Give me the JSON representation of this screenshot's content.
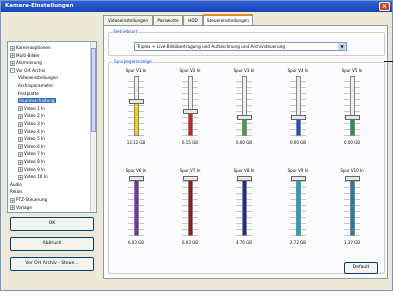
{
  "window": {
    "title": "Kamera-Einstellungen",
    "close": "×"
  },
  "tree": {
    "items": [
      {
        "label": "Kameraoptionen",
        "level": 1,
        "exp": "+"
      },
      {
        "label": "Multi-Bilder",
        "level": 1,
        "exp": "+"
      },
      {
        "label": "Alarmierung",
        "level": 1,
        "exp": "+"
      },
      {
        "label": "Vor Ort Archiv",
        "level": 1,
        "exp": "-"
      },
      {
        "label": "Videoeinstellungen",
        "level": 2
      },
      {
        "label": "Archivparameter",
        "level": 2
      },
      {
        "label": "Festplatte",
        "level": 2
      },
      {
        "label": "Stummschaltung",
        "level": 2,
        "selected": true
      },
      {
        "label": "Video 1 In",
        "level": 2,
        "exp": "+"
      },
      {
        "label": "Video 2 In",
        "level": 2,
        "exp": "+"
      },
      {
        "label": "Video 3 In",
        "level": 2,
        "exp": "+"
      },
      {
        "label": "Video 4 In",
        "level": 2,
        "exp": "+"
      },
      {
        "label": "Video 5 In",
        "level": 2,
        "exp": "+"
      },
      {
        "label": "Video 6 In",
        "level": 2,
        "exp": "+"
      },
      {
        "label": "Video 7 In",
        "level": 2,
        "exp": "+"
      },
      {
        "label": "Video 8 In",
        "level": 2,
        "exp": "+"
      },
      {
        "label": "Video 9 In",
        "level": 2,
        "exp": "+"
      },
      {
        "label": "Video 10 In",
        "level": 2,
        "exp": "+"
      },
      {
        "label": "Audio",
        "level": 1
      },
      {
        "label": "Relais",
        "level": 1
      },
      {
        "label": "PTZ-Steuerung",
        "level": 1,
        "exp": "+"
      },
      {
        "label": "Vorlage",
        "level": 1,
        "exp": "+"
      }
    ]
  },
  "buttons": {
    "ok": "OK",
    "cancel": "Abbruch",
    "copy": "Vor Ort Archiv - Steue...",
    "default": "Default"
  },
  "tabs": [
    {
      "label": "Videoeinstellungen",
      "active": false
    },
    {
      "label": "Passworte",
      "active": false
    },
    {
      "label": "HDD",
      "active": false
    },
    {
      "label": "Steuereinstellungen",
      "active": true
    }
  ],
  "groups": {
    "mode_title": "Betriebsart",
    "mode_value": "Triplex + Live-Bildübertragung und Aufzeichnung und Archivsteuerung",
    "levels_title": "Spurpegelanzeige"
  },
  "channels": [
    {
      "label": "Spur V1 In",
      "value": "13.12 GB",
      "color": "#f5d10a",
      "level": 0.58
    },
    {
      "label": "Spur V2 In",
      "value": "6.15 GB",
      "color": "#d21e1e",
      "level": 0.42
    },
    {
      "label": "Spur V3 In",
      "value": "0.00 GB",
      "color": "#39a43a",
      "level": 0.32
    },
    {
      "label": "Spur V4 In",
      "value": "0.00 GB",
      "color": "#1f4fc4",
      "level": 0.32
    },
    {
      "label": "Spur V5 In",
      "value": "0.00 GB",
      "color": "#1f9a3e",
      "level": 0.32
    },
    {
      "label": "Spur V6 In",
      "value": "6.03 GB",
      "color": "#7b2fa8",
      "level": 0.96
    },
    {
      "label": "Spur V7 In",
      "value": "6.03 GB",
      "color": "#8e1a1a",
      "level": 0.96
    },
    {
      "label": "Spur V8 In",
      "value": "4.70 GB",
      "color": "#1c2e8a",
      "level": 0.96
    },
    {
      "label": "Spur V9 In",
      "value": "2.72 GB",
      "color": "#18a6c8",
      "level": 0.96
    },
    {
      "label": "Spur V10 In",
      "value": "1.37 GB",
      "color": "#2a78b0",
      "level": 0.96
    }
  ]
}
